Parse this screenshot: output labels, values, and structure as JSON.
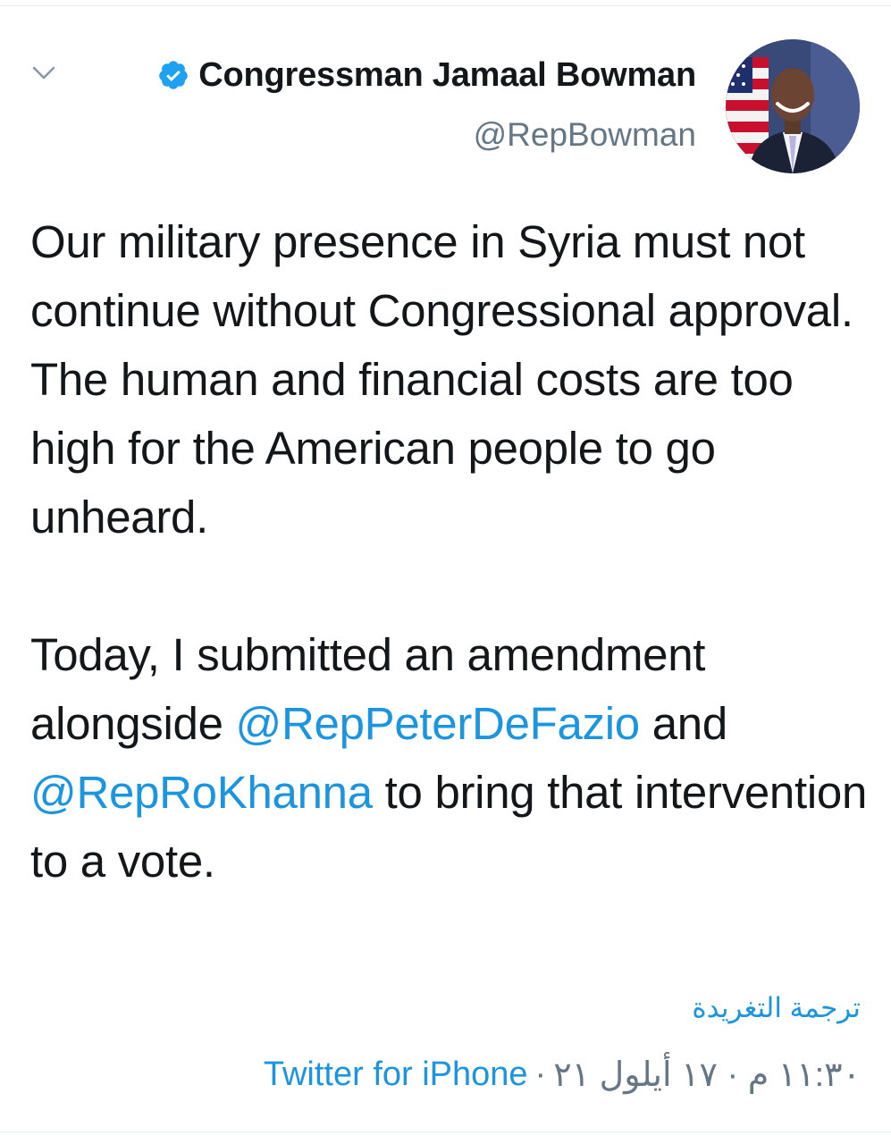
{
  "author": {
    "display_name": "Congressman Jamaal Bowman",
    "handle": "@RepBowman",
    "verified": true
  },
  "tweet": {
    "paragraph1": "Our military presence in Syria must not continue without Congressional approval. The human and financial costs are too high for the American people to go unheard.",
    "paragraph2_start": "Today, I submitted an amendment alongside ",
    "mention1": "@RepPeterDeFazio",
    "paragraph2_mid": " and ",
    "mention2": "@RepRoKhanna",
    "paragraph2_end": " to bring that intervention to a vote."
  },
  "translate_label": "ترجمة التغريدة",
  "meta": {
    "timestamp": "١١:٣٠ م · ١٧ أيلول ٢١",
    "separator": "·",
    "source": "Twitter for iPhone"
  },
  "colors": {
    "link": "#1b95e0",
    "secondary_text": "#657786",
    "primary_text": "#14171a"
  },
  "icons": {
    "menu": "chevron-down-icon",
    "verified": "verified-badge-icon"
  }
}
